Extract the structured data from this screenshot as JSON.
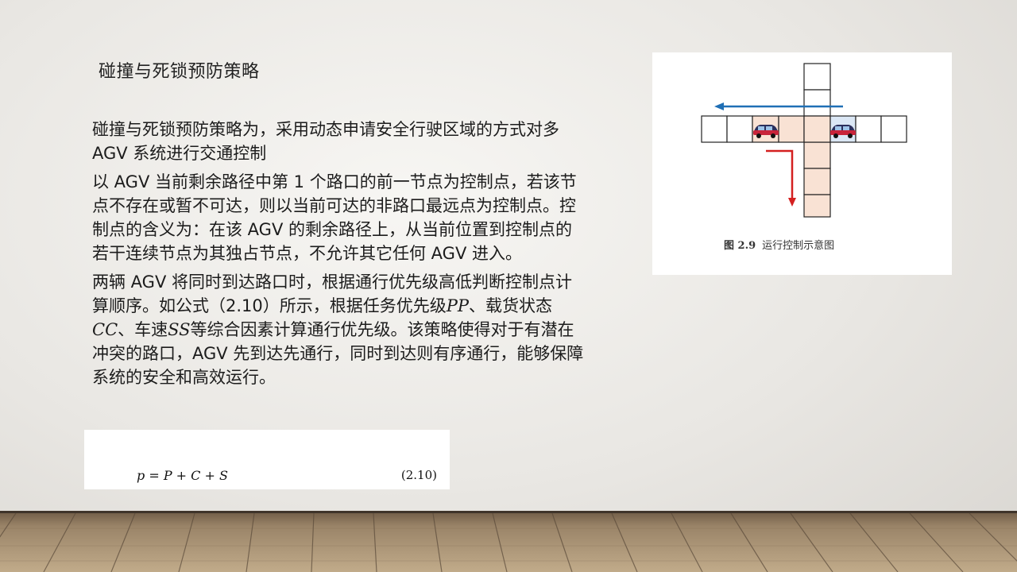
{
  "slide": {
    "title": "碰撞与死锁预防策略",
    "paragraphs": [
      "碰撞与死锁预防策略为，采用动态申请安全行驶区域的方式对多 AGV 系统进行交通控制",
      "以 AGV 当前剩余路径中第 1 个路口的前一节点为控制点，若该节点不存在或暂不可达，则以当前可达的非路口最远点为控制点。控制点的含义为：在该 AGV 的剩余路径上，从当前位置到控制点的若干连续节点为其独占节点，不允许其它任何 AGV 进入。"
    ],
    "para3": {
      "part1": "两辆 AGV 将同时到达路口时，根据通行优先级高低判断控制点计算顺序。如公式（2.10）所示，根据任务优先级",
      "var_p": "PP",
      "part2": "、载货状态",
      "var_c": "CC",
      "part3": "、车速",
      "var_s": "SS",
      "part4": "等综合因素计算通行优先级。该策略使得对于有潜在冲突的路口，AGV 先到达先通行，同时到达则有序通行，能够保障系统的安全和高效运行。"
    },
    "formula": {
      "expression": "p = P + C + S",
      "number": "(2.10)"
    },
    "figure": {
      "caption_number": "图 2.9",
      "caption_text": "运行控制示意图",
      "colors": {
        "blue_arrow": "#1f6fb5",
        "red_arrow": "#d42020",
        "reserved_cell": "#f9e2d4",
        "grid_line": "#222222"
      }
    }
  }
}
